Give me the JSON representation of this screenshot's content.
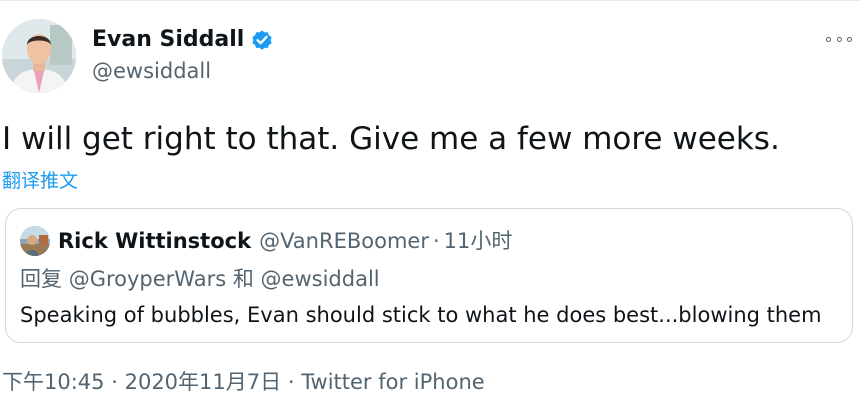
{
  "author": {
    "display_name": "Evan Siddall",
    "handle": "@ewsiddall",
    "verified": true,
    "avatar_icon": "profile-photo"
  },
  "more_icon": "more-horizontal-icon",
  "tweet": {
    "text": "I will get right to that. Give me a few more weeks.",
    "translate_label": "翻译推文"
  },
  "quoted_tweet": {
    "display_name": "Rick Wittinstock",
    "handle": "@VanREBoomer",
    "separator": "·",
    "time_ago": "11小时",
    "reply_prefix": "回复",
    "reply_mention_1": "@GroyperWars",
    "reply_and": "和",
    "reply_mention_2": "@ewsiddall",
    "text": "Speaking of bubbles, Evan should stick to what he does best...blowing them"
  },
  "footer": {
    "time": "下午10:45",
    "separator_1": "·",
    "date": "2020年11月7日",
    "separator_2": "·",
    "source": "Twitter for iPhone"
  },
  "colors": {
    "text_primary": "#0f1419",
    "text_secondary": "#536471",
    "accent": "#1d9bf0",
    "border": "#cfd9de"
  }
}
